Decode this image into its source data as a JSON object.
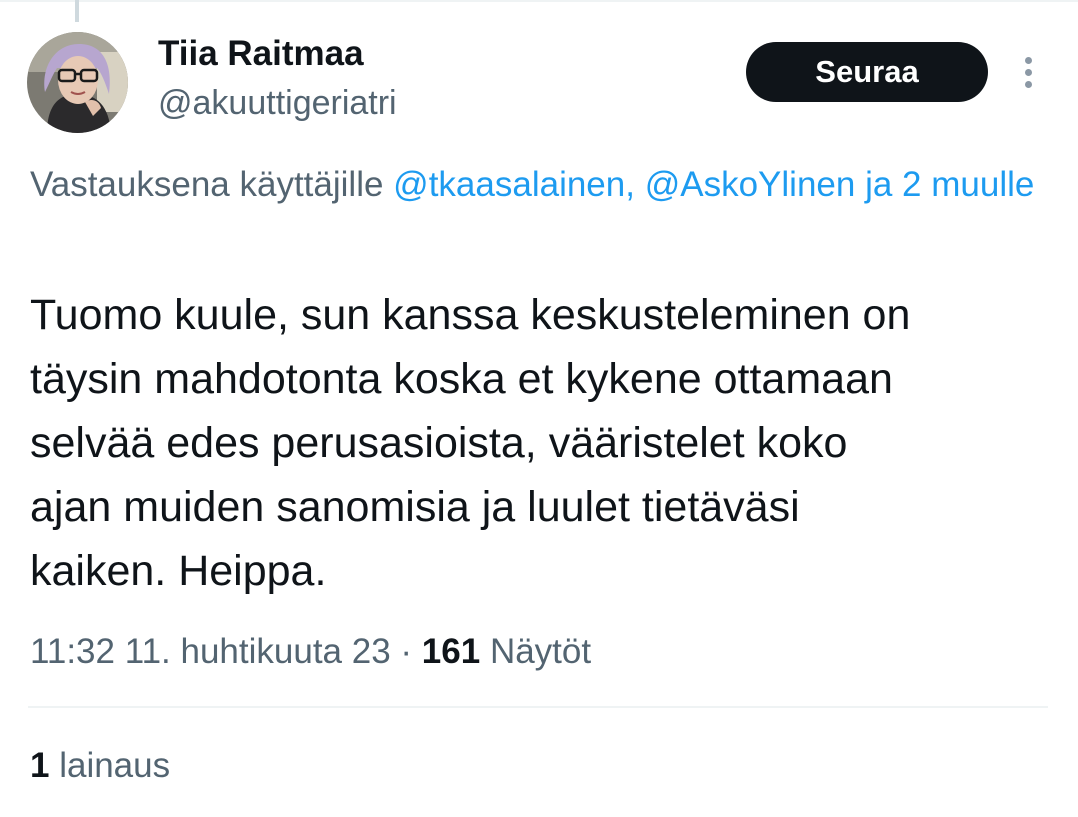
{
  "tweet": {
    "author": {
      "display_name": "Tiia Raitmaa",
      "handle": "@akuuttigeriatri",
      "avatar_icon": "profile-photo"
    },
    "follow_label": "Seuraa",
    "more_icon": "more-vertical-icon",
    "reply_context": {
      "prefix": "Vastauksena käyttäjille",
      "mention_1": "@tkaasalainen,",
      "mention_2": "@AskoYlinen",
      "mention_3": "ja 2 muulle"
    },
    "text": "Tuomo kuule, sun kanssa keskusteleminen on\ntäysin mahdotonta koska et kykene ottamaan\nselvää edes perusasioista, vääristelet koko\najan muiden sanomisia ja luulet tietäväsi\nkaiken. Heippa.",
    "timestamp": "11:32 11. huhtikuuta 23",
    "separator": "·",
    "views_count": "161",
    "views_label": "Näytöt",
    "quotes_count": "1",
    "quotes_label": "lainaus"
  },
  "colors": {
    "text_primary": "#0f1419",
    "text_secondary": "#536471",
    "link": "#1d9bf0",
    "button_bg": "#0f1419",
    "divider": "#eff3f4"
  }
}
